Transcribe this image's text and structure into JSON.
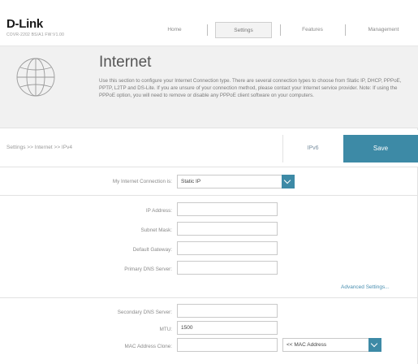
{
  "header": {
    "logo": "D-Link",
    "model": "COVR-2202 BS/A1 FW:V1.00",
    "nav": [
      "Home",
      "Settings",
      "Features",
      "Management"
    ],
    "active_nav": "Settings"
  },
  "banner": {
    "title": "Internet",
    "description": "Use this section to configure your Internet Connection type. There are several connection types to choose from Static IP, DHCP, PPPoE, PPTP, L2TP and DS-Lite. If you are unsure of your connection method, please contact your Internet service provider. Note: If using the PPPoE option, you will need to remove or disable any PPPoE client software on your computers."
  },
  "breadcrumb": "Settings >> Internet >> IPv4",
  "actions": {
    "ipv6": "IPv6",
    "save": "Save"
  },
  "form": {
    "connection_label": "My Internet Connection is:",
    "connection_value": "Static IP",
    "ip_address_label": "IP Address:",
    "ip_address_value": "",
    "subnet_mask_label": "Subnet Mask:",
    "subnet_mask_value": "",
    "gateway_label": "Default Gateway:",
    "gateway_value": "",
    "primary_dns_label": "Primary DNS Server:",
    "primary_dns_value": "",
    "advanced_link": "Advanced Settings...",
    "secondary_dns_label": "Secondary DNS Server:",
    "secondary_dns_value": "",
    "mtu_label": "MTU:",
    "mtu_value": "1500",
    "mac_clone_label": "MAC Address Clone:",
    "mac_clone_value": "",
    "mac_select_value": "<< MAC Address"
  },
  "colors": {
    "accent": "#3d8aa6",
    "banner_bg": "#f1f1f1"
  }
}
